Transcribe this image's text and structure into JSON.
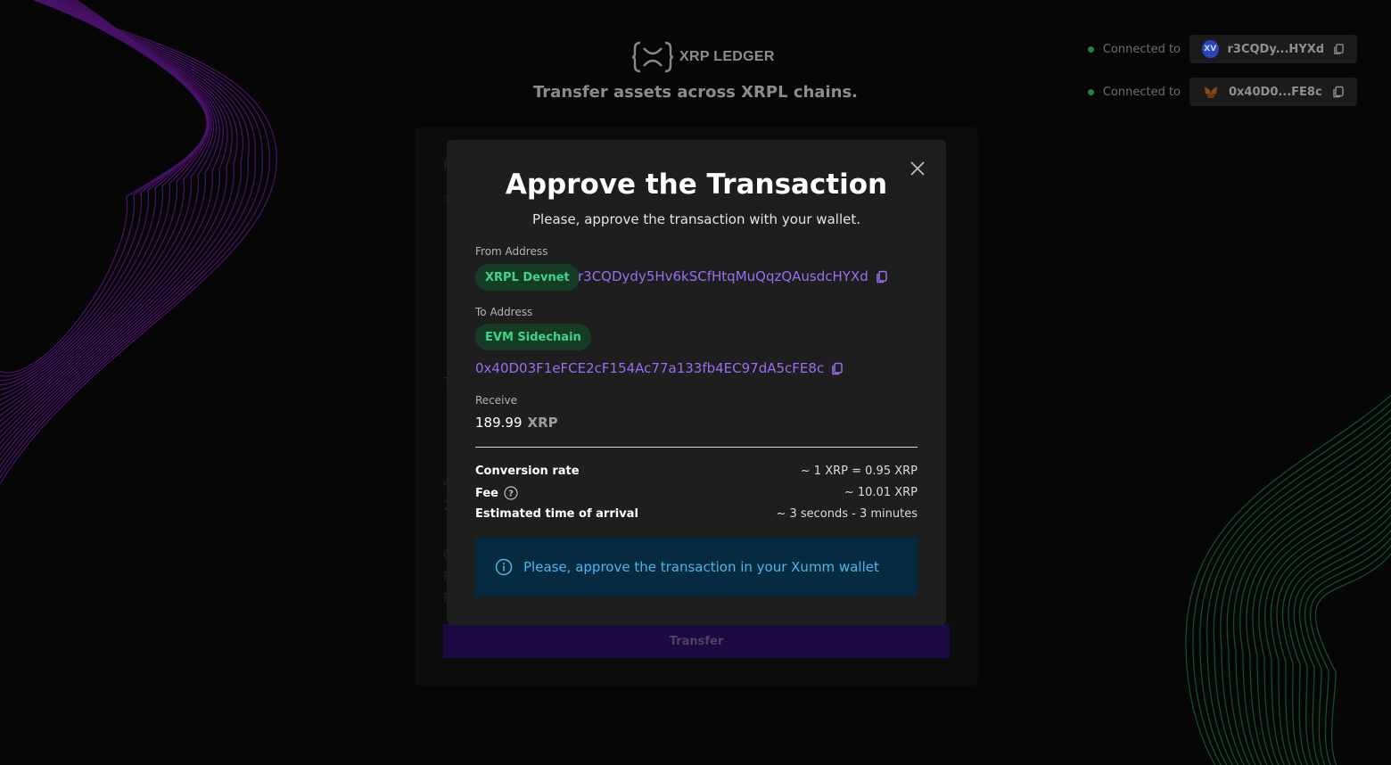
{
  "header": {
    "logo_text": "XRP LEDGER",
    "tagline": "Transfer assets across XRPL chains."
  },
  "connections": [
    {
      "label": "Connected to",
      "address": "r3CQDy...HYXd",
      "wallet_icon": "xumm-icon"
    },
    {
      "label": "Connected to",
      "address": "0x40D0...FE8c",
      "wallet_icon": "metamask-fox-icon"
    }
  ],
  "background_form": {
    "transfer_label": "Transfer"
  },
  "modal": {
    "title": "Approve the Transaction",
    "subtitle": "Please, approve the transaction with your wallet.",
    "from_label": "From Address",
    "from_chain": "XRPL Devnet",
    "from_address": "r3CQDydy5Hv6kSCfHtqMuQqzQAusdcHYXd",
    "to_label": "To Address",
    "to_chain": "EVM Sidechain",
    "to_address": "0x40D03F1eFCE2cF154Ac77a133fb4EC97dA5cFE8c",
    "receive_label": "Receive",
    "receive_amount": "189.99",
    "receive_currency": "XRP",
    "details": [
      {
        "key": "Conversion rate",
        "value": "~ 1 XRP = 0.95 XRP"
      },
      {
        "key": "Fee",
        "value": "~ 10.01 XRP"
      },
      {
        "key": "Estimated time of arrival",
        "value": "~ 3 seconds - 3 minutes"
      }
    ],
    "info_message": "Please, approve the transaction in your Xumm wallet"
  },
  "colors": {
    "background": "#0b0b0b",
    "modal": "#1e1e1e",
    "accent_purple": "#9b6df0",
    "chain_badge_text": "#3ad68a",
    "info_bg": "#062a40",
    "info_text": "#4ab8ee",
    "transfer_button": "#36137a",
    "wave_left": "#8a22c8",
    "wave_right": "#1f9a57"
  }
}
